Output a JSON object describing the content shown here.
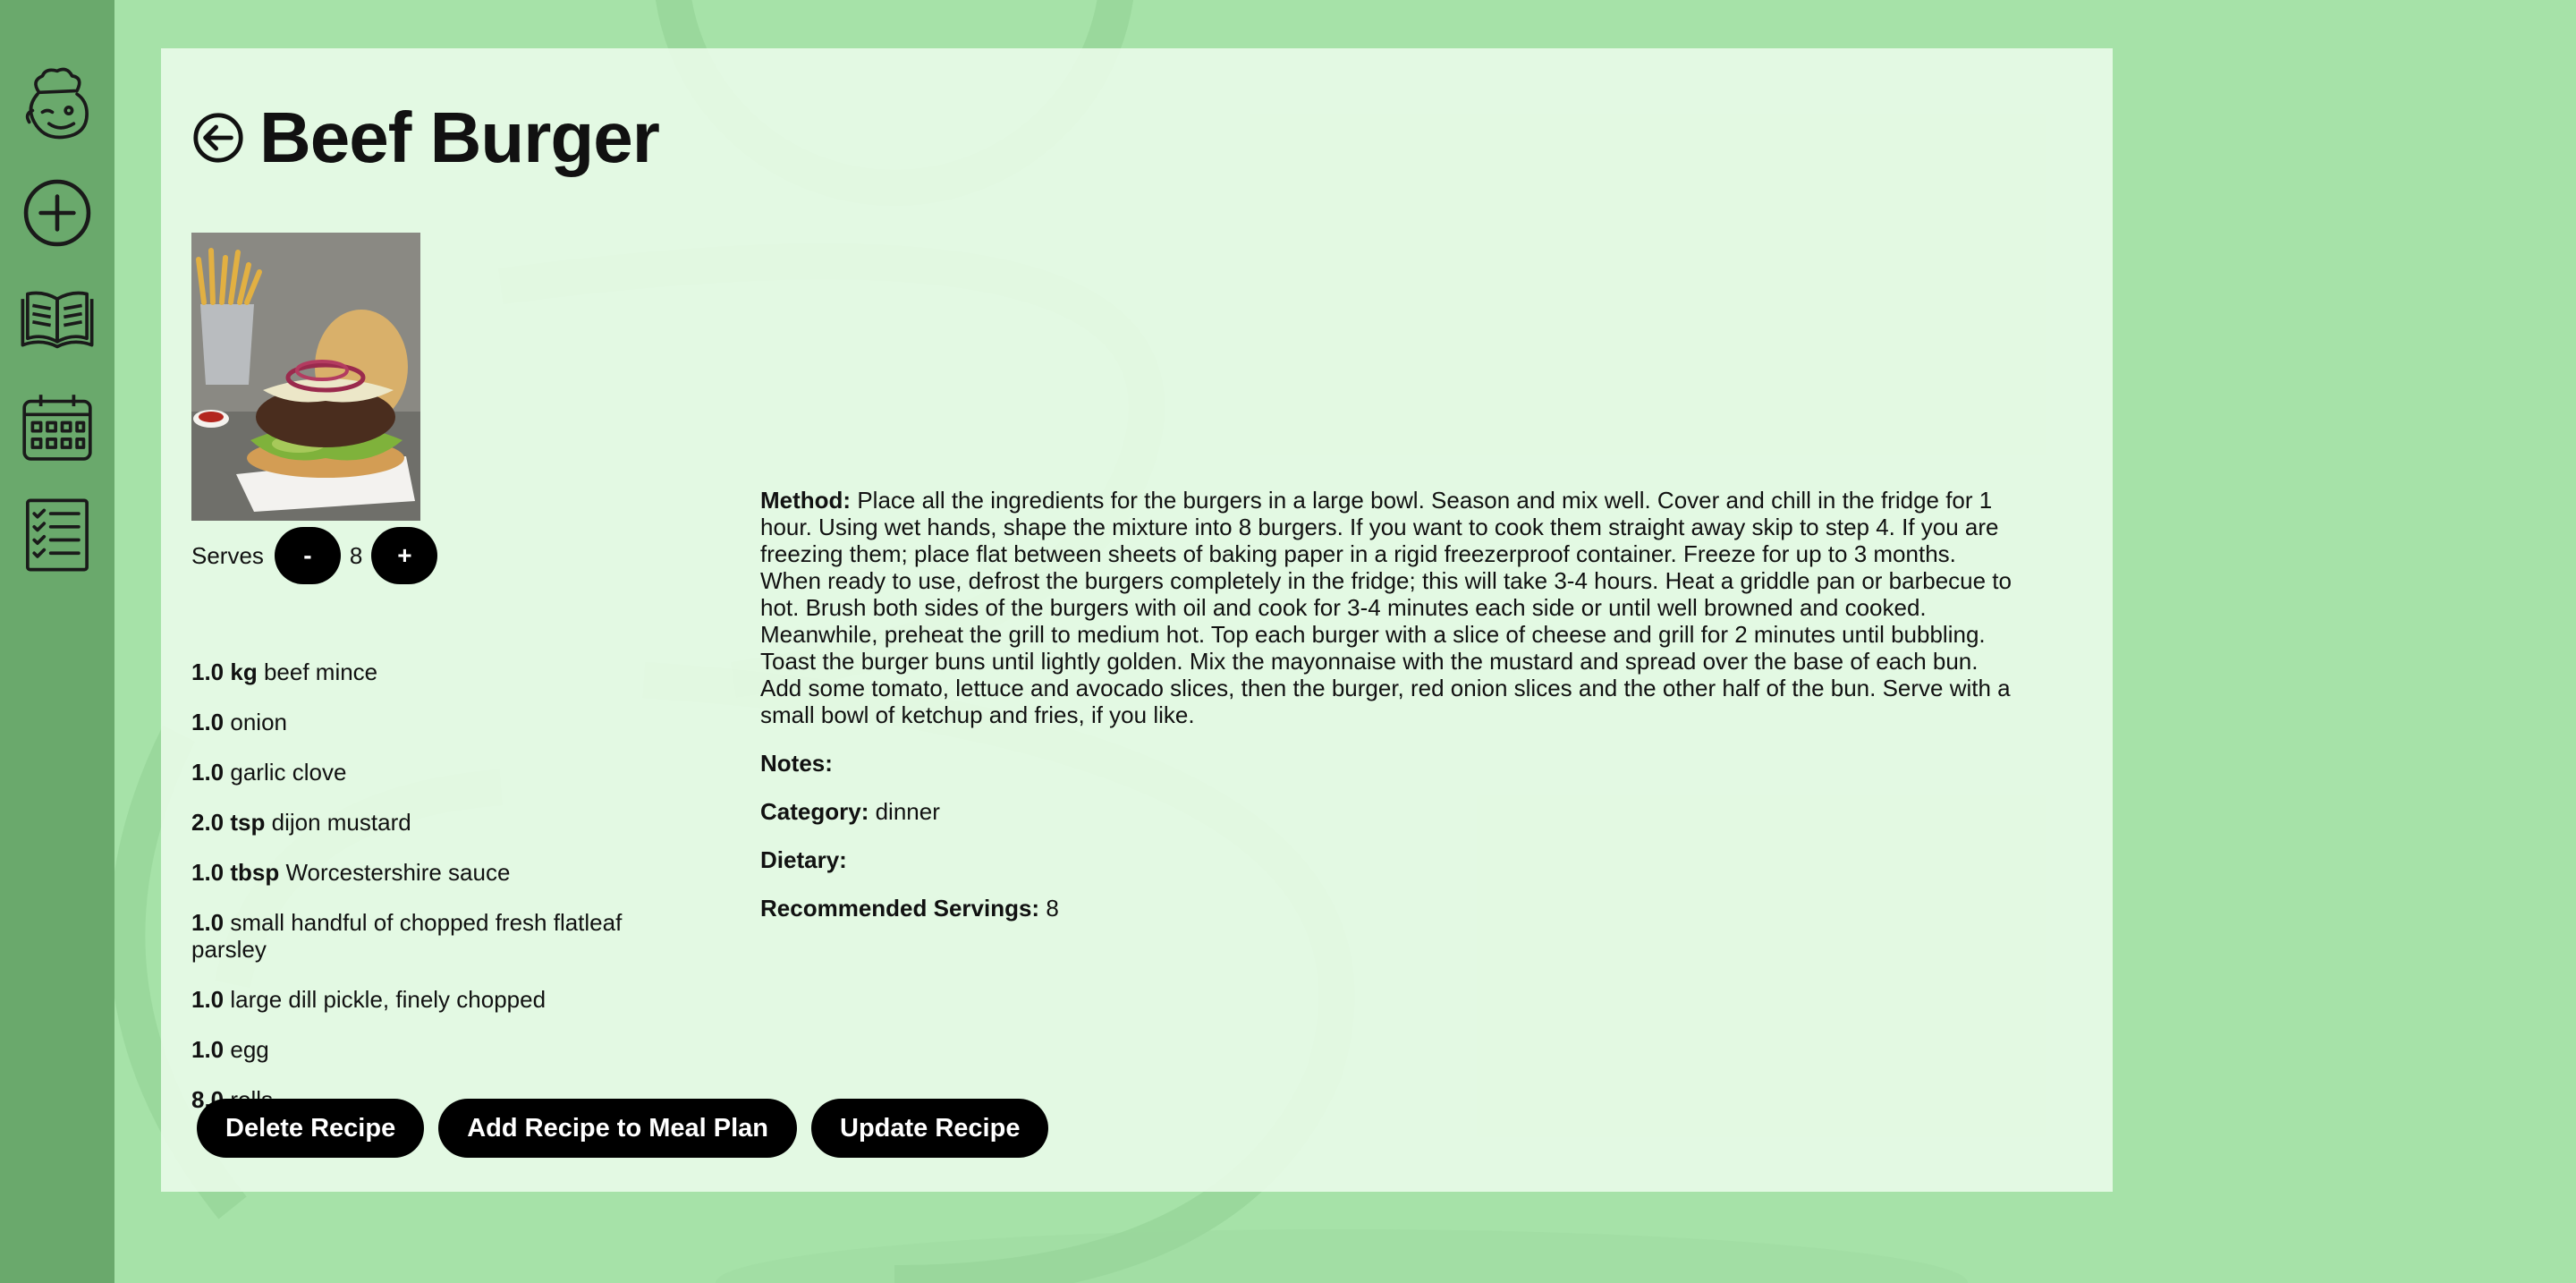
{
  "sidebar": {
    "items": [
      {
        "icon": "chef-logo-icon"
      },
      {
        "icon": "plus-circle-icon"
      },
      {
        "icon": "open-book-icon"
      },
      {
        "icon": "calendar-icon"
      },
      {
        "icon": "checklist-icon"
      }
    ]
  },
  "recipe": {
    "title": "Beef Burger",
    "serves_label": "Serves",
    "serves": "8",
    "decrement_label": "-",
    "increment_label": "+",
    "image_alt": "Beef burger with fries"
  },
  "ingredients": [
    {
      "qty": "1.0 kg",
      "name": "beef mince"
    },
    {
      "qty": "1.0",
      "name": "onion"
    },
    {
      "qty": "1.0",
      "name": "garlic clove"
    },
    {
      "qty": "2.0 tsp",
      "name": "dijon mustard"
    },
    {
      "qty": "1.0 tbsp",
      "name": "Worcestershire sauce"
    },
    {
      "qty": "1.0",
      "name": "small handful of chopped fresh flatleaf parsley"
    },
    {
      "qty": "1.0",
      "name": "large dill pickle, finely chopped"
    },
    {
      "qty": "1.0",
      "name": "egg"
    },
    {
      "qty": "8.0",
      "name": "rolls"
    }
  ],
  "details": {
    "method_label": "Method:",
    "method": "Place all the ingredients for the burgers in a large bowl. Season and mix well. Cover and chill in the fridge for 1 hour. Using wet hands, shape the mixture into 8 burgers. If you want to cook them straight away skip to step 4. If you are freezing them; place flat between sheets of baking paper in a rigid freezerproof container. Freeze for up to 3 months. When ready to use, defrost the burgers completely in the fridge; this will take 3-4 hours. Heat a griddle pan or barbecue to hot. Brush both sides of the burgers with oil and cook for 3-4 minutes each side or until well browned and cooked. Meanwhile, preheat the grill to medium hot. Top each burger with a slice of cheese and grill for 2 minutes until bubbling. Toast the burger buns until lightly golden. Mix the mayonnaise with the mustard and spread over the base of each bun. Add some tomato, lettuce and avocado slices, then the burger, red onion slices and the other half of the bun. Serve with a small bowl of ketchup and fries, if you like.",
    "notes_label": "Notes:",
    "notes": "",
    "category_label": "Category:",
    "category": "dinner",
    "dietary_label": "Dietary:",
    "dietary": "",
    "recommended_label": "Recommended Servings:",
    "recommended": "8"
  },
  "actions": {
    "delete": "Delete Recipe",
    "add_to_plan": "Add Recipe to Meal Plan",
    "update": "Update Recipe"
  },
  "colors": {
    "background": "#a6e2a8",
    "sidebar": "#6aa96c",
    "card": "#ecfcea",
    "button": "#000000"
  }
}
